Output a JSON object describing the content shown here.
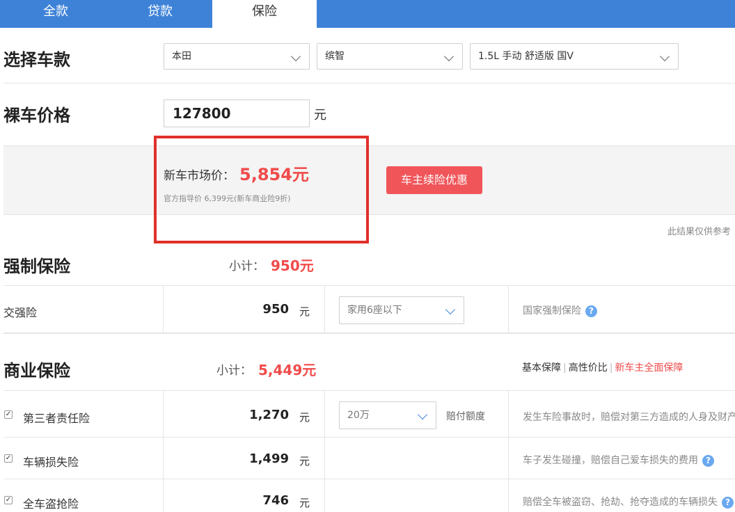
{
  "tabs": [
    {
      "label": "全款",
      "active": false
    },
    {
      "label": "贷款",
      "active": false
    },
    {
      "label": "保险",
      "active": true
    }
  ],
  "car_select": {
    "title": "选择车款",
    "brand": "本田",
    "model": "缤智",
    "trim": "1.5L 手动 舒适版 国V"
  },
  "price": {
    "title": "裸车价格",
    "value": "127800",
    "unit": "元"
  },
  "market": {
    "label": "新车市场价：",
    "value": "5,854元",
    "note": "官方指导价 6,399元(新车商业险9折)",
    "promo_button": "车主续险优惠",
    "disclaimer": "此结果仅供参考"
  },
  "compulsory": {
    "title": "强制保险",
    "subtotal_label": "小计：",
    "subtotal_value": "950元",
    "rows": [
      {
        "name": "交强险",
        "amount": "950",
        "unit": "元",
        "option": "家用6座以下",
        "desc": "国家强制保险"
      }
    ]
  },
  "commercial": {
    "title": "商业保险",
    "subtotal_label": "小计：",
    "subtotal_value": "5,449元",
    "plans": [
      "基本保障",
      "高性价比",
      "新车主全面保障"
    ],
    "rows": [
      {
        "name": "第三者责任险",
        "amount": "1,270",
        "unit": "元",
        "option": "20万",
        "option_note": "赔付额度",
        "desc": "发生车险事故时，赔偿对第三方造成的人身及财产"
      },
      {
        "name": "车辆损失险",
        "amount": "1,499",
        "unit": "元",
        "desc": "车子发生碰撞，赔偿自己爱车损失的费用"
      },
      {
        "name": "全车盗抢险",
        "amount": "746",
        "unit": "元",
        "desc": "赔偿全车被盗窃、抢劫、抢夺造成的车辆损失"
      }
    ]
  },
  "icons": {
    "chevron": "chevron-down-icon",
    "help": "question-icon",
    "check": "checkbox-checked-icon"
  },
  "colors": {
    "tab_bar": "#3e82d7",
    "accent_red": "#f04b4b",
    "promo_button": "#f0555a",
    "highlight_box": "#e0302a"
  }
}
